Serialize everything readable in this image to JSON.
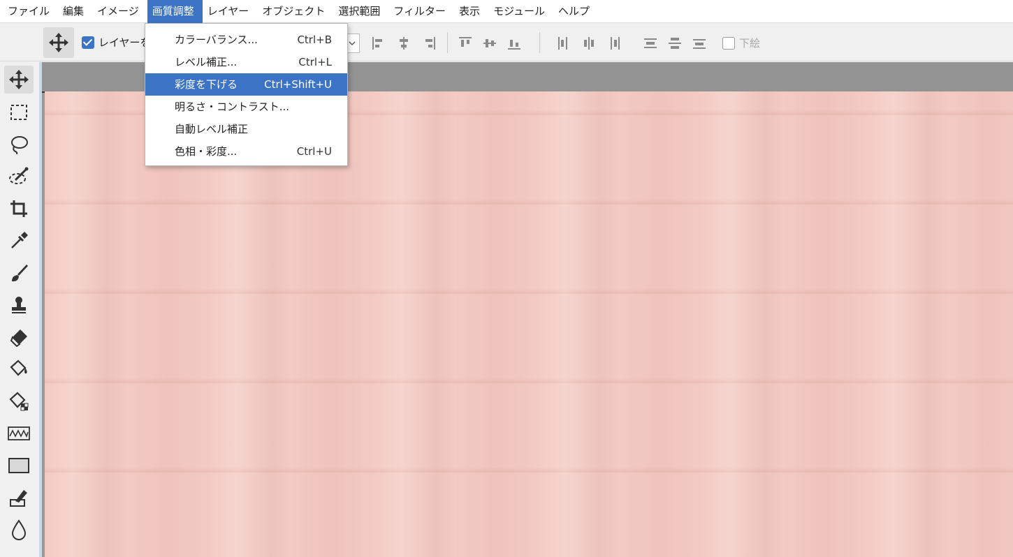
{
  "menubar": {
    "items": [
      {
        "label": "ファイル"
      },
      {
        "label": "編集"
      },
      {
        "label": "イメージ"
      },
      {
        "label": "画質調整",
        "active": true
      },
      {
        "label": "レイヤー"
      },
      {
        "label": "オブジェクト"
      },
      {
        "label": "選択範囲"
      },
      {
        "label": "フィルター"
      },
      {
        "label": "表示"
      },
      {
        "label": "モジュール"
      },
      {
        "label": "ヘルプ"
      }
    ]
  },
  "options_bar": {
    "move_tool_icon": "move-icon",
    "auto_select_label": "レイヤーを",
    "auto_select_checked": true,
    "draw_below_label": "下絵",
    "draw_below_checked": false
  },
  "dropdown": {
    "items": [
      {
        "label": "カラーバランス...",
        "shortcut": "Ctrl+B"
      },
      {
        "label": "レベル補正...",
        "shortcut": "Ctrl+L"
      },
      {
        "label": "彩度を下げる",
        "shortcut": "Ctrl+Shift+U",
        "highlighted": true
      },
      {
        "label": "明るさ・コントラスト...",
        "shortcut": ""
      },
      {
        "label": "自動レベル補正",
        "shortcut": ""
      },
      {
        "label": "色相・彩度...",
        "shortcut": "Ctrl+U"
      }
    ]
  },
  "toolbar": {
    "tools": [
      "move-icon",
      "marquee-icon",
      "lasso-icon",
      "magic-wand-icon",
      "crop-icon",
      "eyedropper-icon",
      "brush-icon",
      "stamp-icon",
      "eraser-icon",
      "fill-bucket-icon",
      "pattern-fill-icon",
      "wave-brush-icon",
      "rectangle-icon",
      "pen-icon",
      "water-drop-icon"
    ]
  },
  "colors": {
    "accent": "#3b73c5",
    "image_tint": "#f3cbc3"
  }
}
